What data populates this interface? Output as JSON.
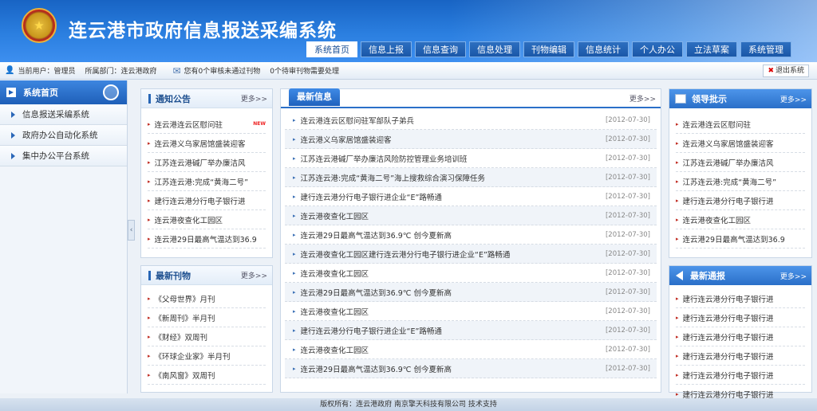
{
  "header": {
    "title": "连云港市政府信息报送采编系统",
    "nav": [
      "系统首页",
      "信息上报",
      "信息查询",
      "信息处理",
      "刊物编辑",
      "信息统计",
      "个人办公",
      "立法草案",
      "系统管理"
    ]
  },
  "infobar": {
    "user": "当前用户：管理员",
    "dept": "所属部门：连云港政府",
    "msg1": "您有0个审核未通过刊物",
    "msg2": "0个待审刊物需要处理",
    "logout": "退出系统"
  },
  "sidebar": {
    "title": "系统首页",
    "items": [
      "信息报送采编系统",
      "政府办公自动化系统",
      "集中办公平台系统"
    ]
  },
  "notice": {
    "title": "通知公告",
    "more": "更多>>",
    "new_badge": "NEW",
    "items": [
      "连云港连云区慰问驻",
      "连云港义乌家居馆盛装迎客",
      "江苏连云港碱厂举办廉洁风",
      "江苏连云港:完成“黄海二号”",
      "建行连云港分行电子银行进",
      "连云港夜查化工园区",
      "连云港29日最高气温达到36.9"
    ]
  },
  "journal": {
    "title": "最新刊物",
    "more": "更多>>",
    "items": [
      "《父母世界》月刊",
      "《新周刊》半月刊",
      "《财经》双周刊",
      "《环球企业家》半月刊",
      "《南风窗》双周刊"
    ]
  },
  "latest": {
    "title": "最新信息",
    "more": "更多>>",
    "rows": [
      {
        "t": "连云港连云区慰问驻军部队子弟兵",
        "d": "[2012-07-30]"
      },
      {
        "t": "连云港义乌家居馆盛装迎客",
        "d": "[2012-07-30]"
      },
      {
        "t": "江苏连云港碱厂举办廉洁风险防控管理业务培训班",
        "d": "[2012-07-30]"
      },
      {
        "t": "江苏连云港:完成“黄海二号”海上搜救综合演习保障任务",
        "d": "[2012-07-30]"
      },
      {
        "t": "建行连云港分行电子银行进企业“E”路畅通",
        "d": "[2012-07-30]"
      },
      {
        "t": "连云港夜查化工园区",
        "d": "[2012-07-30]"
      },
      {
        "t": "连云港29日最高气温达到36.9℃ 创今夏新高",
        "d": "[2012-07-30]"
      },
      {
        "t": "连云港夜查化工园区建行连云港分行电子银行进企业“E”路畅通",
        "d": "[2012-07-30]"
      },
      {
        "t": "连云港夜查化工园区",
        "d": "[2012-07-30]"
      },
      {
        "t": "连云港29日最高气温达到36.9℃ 创今夏新高",
        "d": "[2012-07-30]"
      },
      {
        "t": "连云港夜查化工园区",
        "d": "[2012-07-30]"
      },
      {
        "t": "建行连云港分行电子银行进企业“E”路畅通",
        "d": "[2012-07-30]"
      },
      {
        "t": "连云港夜查化工园区",
        "d": "[2012-07-30]"
      },
      {
        "t": "连云港29日最高气温达到36.9℃ 创今夏新高",
        "d": "[2012-07-30]"
      }
    ]
  },
  "leader": {
    "title": "领导批示",
    "more": "更多>>",
    "items": [
      "连云港连云区慰问驻",
      "连云港义乌家居馆盛装迎客",
      "江苏连云港碱厂举办廉洁风",
      "江苏连云港:完成“黄海二号”",
      "建行连云港分行电子银行进",
      "连云港夜查化工园区",
      "连云港29日最高气温达到36.9"
    ]
  },
  "bulletin": {
    "title": "最新通报",
    "more": "更多>>",
    "items": [
      "建行连云港分行电子银行进",
      "建行连云港分行电子银行进",
      "建行连云港分行电子银行进",
      "建行连云港分行电子银行进",
      "建行连云港分行电子银行进",
      "建行连云港分行电子银行进"
    ]
  },
  "footer": "版权所有：连云港政府        南京擎天科技有限公司  技术支持",
  "icons": [
    "national-emblem-icon",
    "user-icon",
    "mail-icon",
    "close-icon",
    "home-icon",
    "refresh-icon",
    "image-icon",
    "speaker-icon"
  ],
  "colors": {
    "brand": "#1e5fb8",
    "nav_active": "#ffffff",
    "new_badge": "#ee2222"
  }
}
